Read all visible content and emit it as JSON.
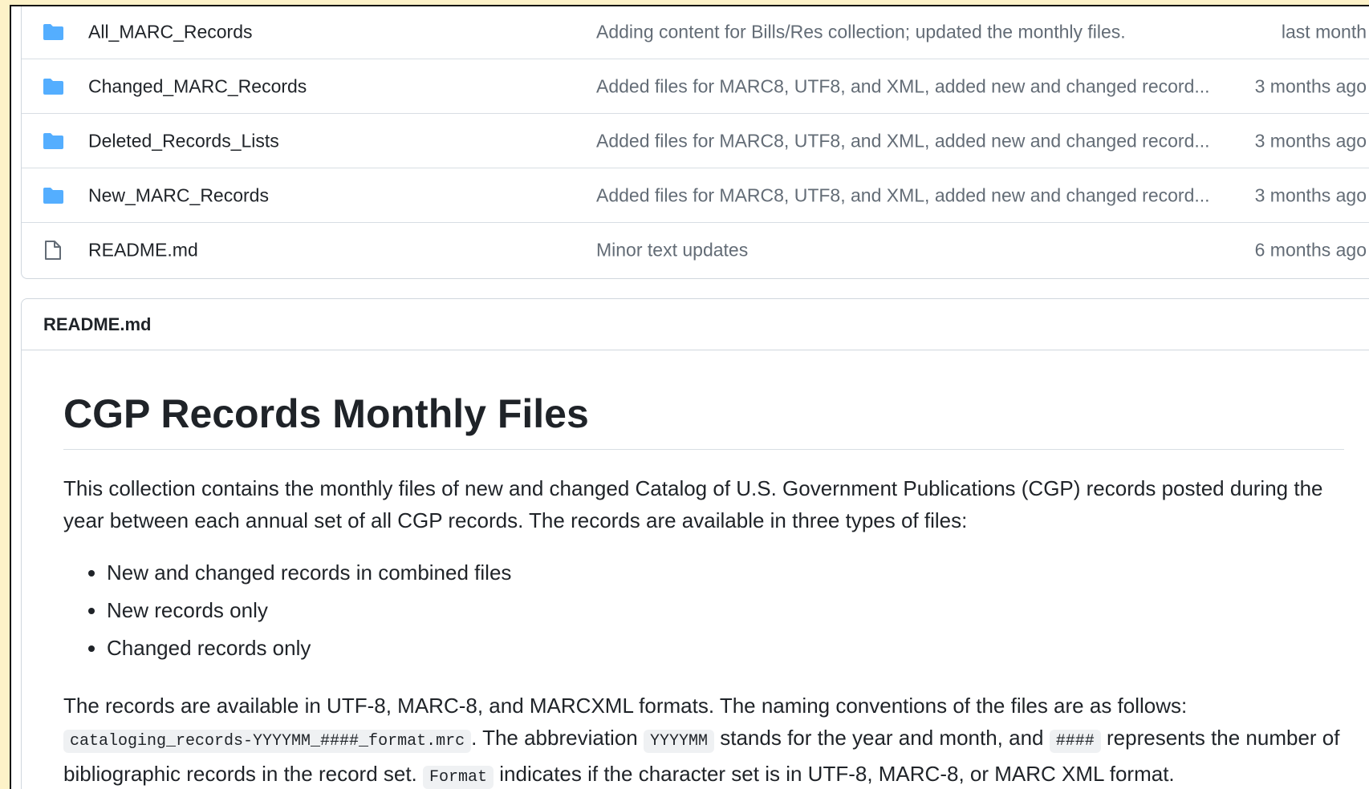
{
  "files": [
    {
      "name": "All_MARC_Records",
      "icon": "folder-icon",
      "message": "Adding content for Bills/Res collection; updated the monthly files.",
      "age": "last month"
    },
    {
      "name": "Changed_MARC_Records",
      "icon": "folder-icon",
      "message": "Added files for MARC8, UTF8, and XML, added new and changed record...",
      "age": "3 months ago"
    },
    {
      "name": "Deleted_Records_Lists",
      "icon": "folder-icon",
      "message": "Added files for MARC8, UTF8, and XML, added new and changed record...",
      "age": "3 months ago"
    },
    {
      "name": "New_MARC_Records",
      "icon": "folder-icon",
      "message": "Added files for MARC8, UTF8, and XML, added new and changed record...",
      "age": "3 months ago"
    },
    {
      "name": "README.md",
      "icon": "file-icon",
      "message": "Minor text updates",
      "age": "6 months ago"
    }
  ],
  "readme": {
    "header": "README.md",
    "title": "CGP Records Monthly Files",
    "intro": "This collection contains the monthly files of new and changed Catalog of U.S. Government Publications (CGP) records posted during the year between each annual set of all CGP records. The records are available in three types of files:",
    "list": [
      "New and changed records in combined files",
      "New records only",
      "Changed records only"
    ],
    "formats_text": "The records are available in UTF-8, MARC-8, and MARCXML formats. The naming conventions of the files are as follows:",
    "code_filename": "cataloging_records-YYYYMM_####_format.mrc",
    "text_abbrev": ". The abbreviation",
    "code_yyyymm": "YYYYMM",
    "text_stands": "stands for the year and month, and",
    "code_hash": "####",
    "text_represents": "represents the number of bibliographic records in the record set.",
    "code_format": "Format",
    "text_indicates": "indicates if the character set is in UTF-8, MARC-8, or MARC XML format."
  },
  "colors": {
    "folder": "#54aeff",
    "muted_text": "#636c76",
    "border": "#d0d7de",
    "outer_background": "#fdf2c8"
  }
}
